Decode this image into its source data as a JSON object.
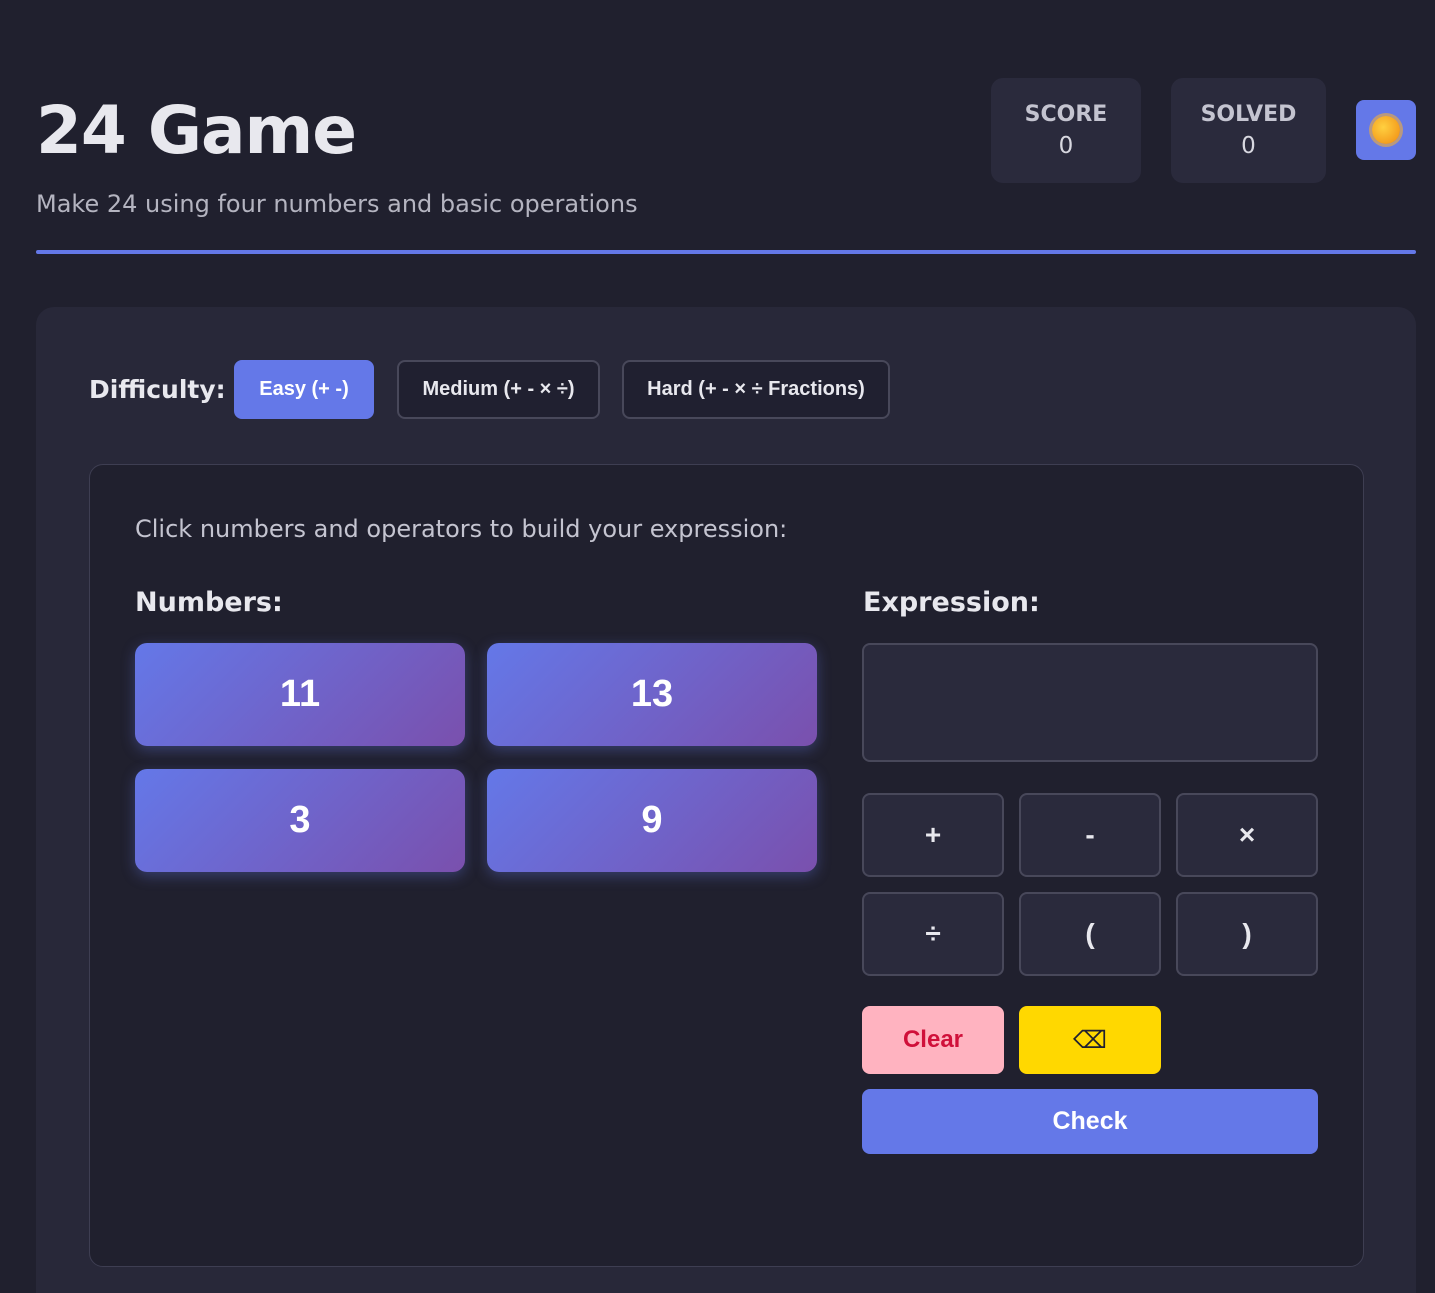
{
  "header": {
    "title": "24 Game",
    "subtitle": "Make 24 using four numbers and basic operations",
    "score_label": "SCORE",
    "score_value": "0",
    "solved_label": "SOLVED",
    "solved_value": "0",
    "theme_icon": "sun-icon"
  },
  "difficulty": {
    "label": "Difficulty:",
    "options": [
      "Easy (+ -)",
      "Medium (+ - × ÷)",
      "Hard (+ - × ÷ Fractions)"
    ],
    "selected": "Easy (+ -)"
  },
  "board": {
    "instructions": "Click numbers and operators to build your expression:",
    "numbers_label": "Numbers:",
    "numbers": [
      "11",
      "13",
      "3",
      "9"
    ],
    "expression_label": "Expression:",
    "expression_value": "",
    "operators": [
      "+",
      "-",
      "×",
      "÷",
      "(",
      ")"
    ],
    "clear_label": "Clear",
    "backspace_label": "⌫",
    "check_label": "Check"
  },
  "colors": {
    "background": "#20202e",
    "panel": "#282839",
    "accent": "#6478e8",
    "clear": "#ffb3c0",
    "backspace": "#ffd800"
  }
}
